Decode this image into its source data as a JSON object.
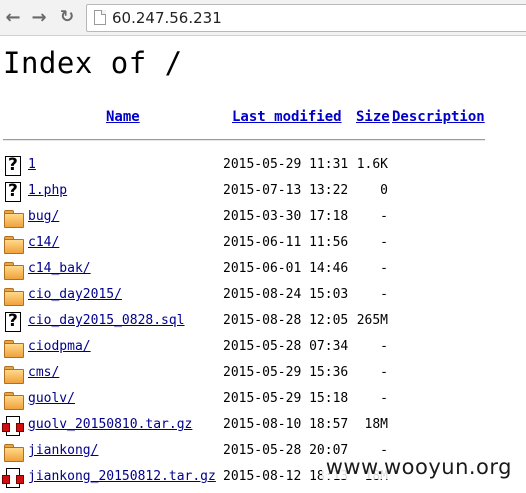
{
  "browser": {
    "url": "60.247.56.231"
  },
  "page": {
    "title": "Index of /"
  },
  "columns": {
    "name": "Name",
    "modified": "Last modified",
    "size": "Size",
    "description": "Description"
  },
  "entries": [
    {
      "name": "1",
      "modified": "2015-05-29 11:31",
      "size": "1.6K",
      "icon": "unknown-file-icon"
    },
    {
      "name": "1.php",
      "modified": "2015-07-13 13:22",
      "size": "0",
      "icon": "unknown-file-icon"
    },
    {
      "name": "bug/",
      "modified": "2015-03-30 17:18",
      "size": "-",
      "icon": "folder-icon"
    },
    {
      "name": "c14/",
      "modified": "2015-06-11 11:56",
      "size": "-",
      "icon": "folder-icon"
    },
    {
      "name": "c14_bak/",
      "modified": "2015-06-01 14:46",
      "size": "-",
      "icon": "folder-icon"
    },
    {
      "name": "cio_day2015/",
      "modified": "2015-08-24 15:03",
      "size": "-",
      "icon": "folder-icon"
    },
    {
      "name": "cio_day2015_0828.sql",
      "modified": "2015-08-28 12:05",
      "size": "265M",
      "icon": "unknown-file-icon"
    },
    {
      "name": "ciodpma/",
      "modified": "2015-05-28 07:34",
      "size": "-",
      "icon": "folder-icon"
    },
    {
      "name": "cms/",
      "modified": "2015-05-29 15:36",
      "size": "-",
      "icon": "folder-icon"
    },
    {
      "name": "guolv/",
      "modified": "2015-05-29 15:18",
      "size": "-",
      "icon": "folder-icon"
    },
    {
      "name": "guolv_20150810.tar.gz",
      "modified": "2015-08-10 18:57",
      "size": "18M",
      "icon": "compressed-file-icon"
    },
    {
      "name": "jiankong/",
      "modified": "2015-05-28 20:07",
      "size": "-",
      "icon": "folder-icon"
    },
    {
      "name": "jiankong_20150812.tar.gz",
      "modified": "2015-08-12 18:13",
      "size": "18M",
      "icon": "compressed-file-icon"
    }
  ],
  "watermark": "www.wooyun.org",
  "colors": {
    "link": "#00008b",
    "header_link": "#0000c8",
    "folder": "#f0a23c"
  }
}
